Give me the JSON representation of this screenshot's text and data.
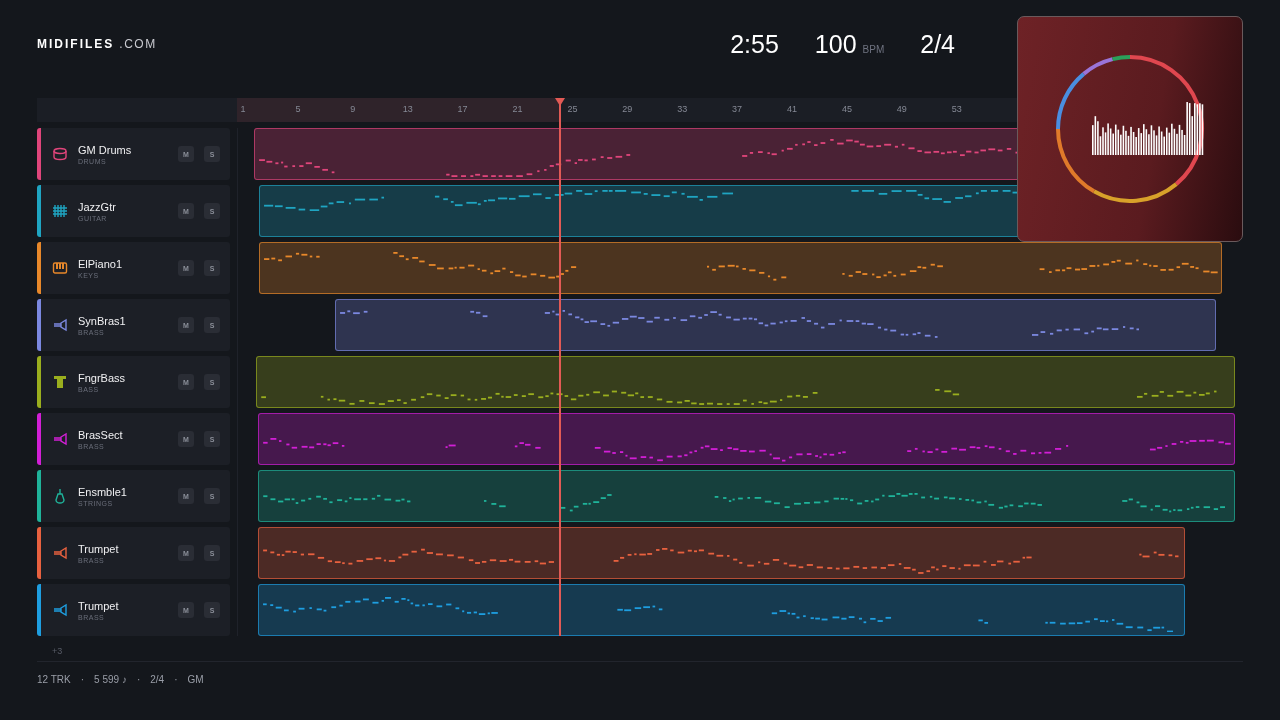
{
  "brand": {
    "name": "MIDIFILES",
    "suffix": ".COM"
  },
  "transport": {
    "time": "2:55",
    "tempo": "100",
    "tempo_unit": "BPM",
    "meter": "2/4"
  },
  "ruler": {
    "labels": [
      "1",
      "5",
      "9",
      "13",
      "17",
      "21",
      "25",
      "29",
      "33",
      "37",
      "41",
      "45",
      "49",
      "53"
    ],
    "playhead": {
      "level": 0.32
    }
  },
  "tracks": [
    {
      "name": "GM Drums",
      "category": "DRUMS",
      "kind": "drums",
      "color": "#e0457b",
      "mute": "M",
      "solo": "S"
    },
    {
      "name": "JazzGtr",
      "category": "GUITAR",
      "kind": "guitar",
      "color": "#1fa5c2",
      "mute": "M",
      "solo": "S"
    },
    {
      "name": "ElPiano1",
      "category": "KEYS",
      "kind": "keys",
      "color": "#e8882a",
      "mute": "M",
      "solo": "S"
    },
    {
      "name": "SynBras1",
      "category": "BRASS",
      "kind": "brass",
      "color": "#7b88e0",
      "mute": "M",
      "solo": "S"
    },
    {
      "name": "FngrBass",
      "category": "BASS",
      "kind": "bass",
      "color": "#9aae1e",
      "mute": "M",
      "solo": "S"
    },
    {
      "name": "BrasSect",
      "category": "BRASS",
      "kind": "brass",
      "color": "#d21fd6",
      "mute": "M",
      "solo": "S"
    },
    {
      "name": "Ensmble1",
      "category": "STRINGS",
      "kind": "strings",
      "color": "#1fb39a",
      "mute": "M",
      "solo": "S"
    },
    {
      "name": "Trumpet",
      "category": "BRASS",
      "kind": "brass",
      "color": "#e8613f",
      "mute": "M",
      "solo": "S"
    },
    {
      "name": "Trumpet",
      "category": "BRASS",
      "kind": "brass",
      "color": "#1e9ee0",
      "mute": "M",
      "solo": "S"
    }
  ],
  "more_tracks": "+3",
  "stats": {
    "items": [
      "12 TRK",
      "5 599 ♪",
      "2/4",
      "GM"
    ],
    "separator": "·"
  }
}
